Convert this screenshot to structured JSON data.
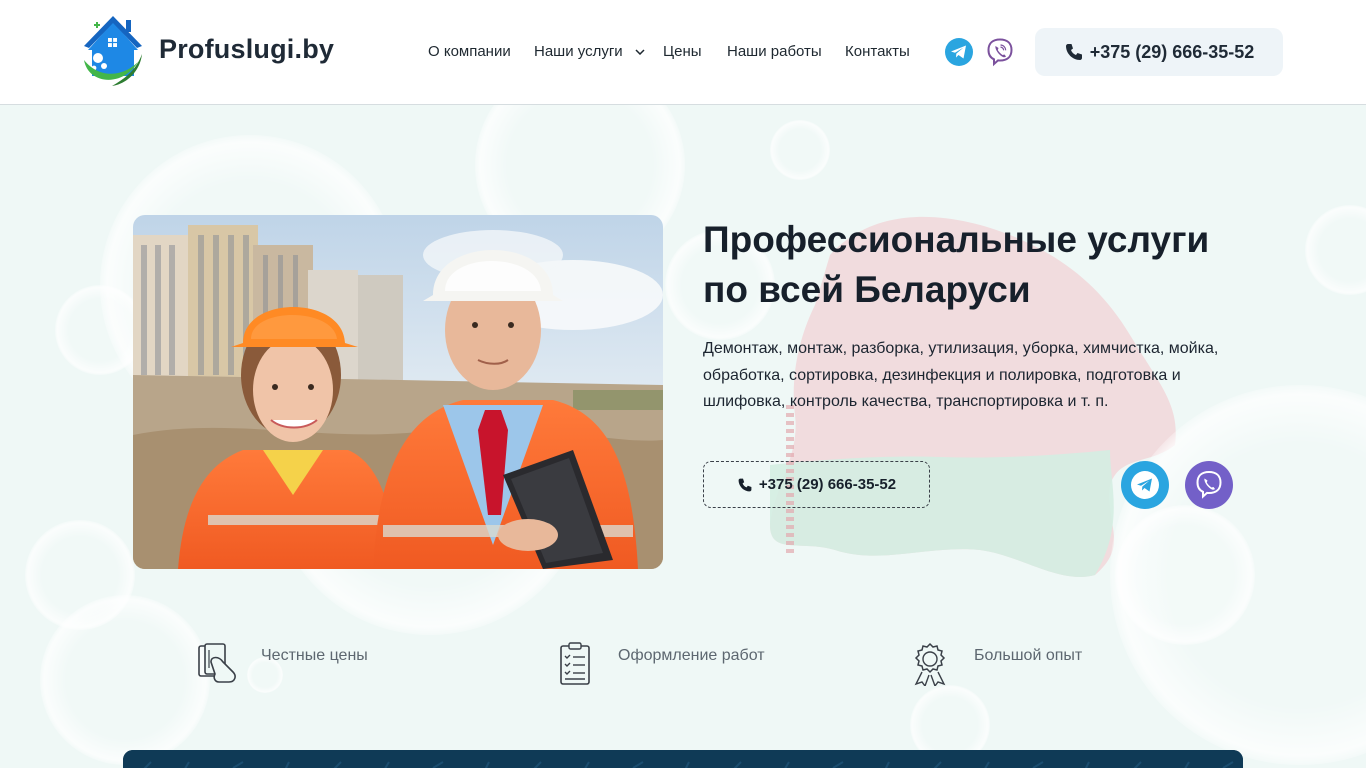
{
  "header": {
    "brand": "Profuslugi.by",
    "nav": [
      {
        "label": "О компании"
      },
      {
        "label": "Наши услуги",
        "has_dropdown": true
      },
      {
        "label": "Цены"
      },
      {
        "label": "Наши работы"
      },
      {
        "label": "Контакты"
      }
    ],
    "phone": "+375 (29) 666-35-52"
  },
  "hero": {
    "title": "Профессиональные услуги по всей Беларуси",
    "description": "Демонтаж, монтаж, разборка, утилизация, уборка, химчистка, мойка, обработка, сортировка,  дезинфекция и полировка, подготовка и шлифовка, контроль качества, транспортировка и т. п.",
    "phone": "+375 (29) 666-35-52"
  },
  "features": [
    {
      "label": "Честные цены",
      "icon": "price-tag-icon"
    },
    {
      "label": "Оформление работ",
      "icon": "clipboard-icon"
    },
    {
      "label": "Большой опыт",
      "icon": "award-icon"
    }
  ],
  "colors": {
    "telegram": "#2aa5e0",
    "viber": "#7360c8",
    "hero_bg": "#eff8f6",
    "bottom_band": "#0f3a56"
  }
}
